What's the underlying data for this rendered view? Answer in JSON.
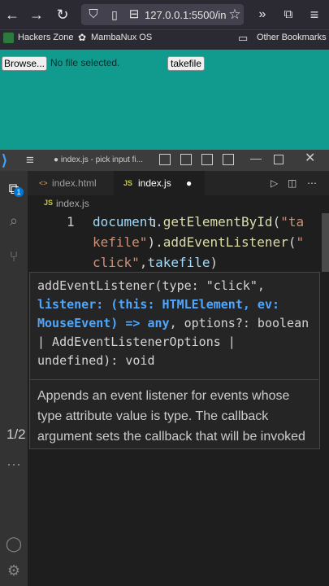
{
  "browser": {
    "url": "127.0.0.1:5500/in",
    "bookmarks": [
      "Hackers Zone",
      "MambaNux OS",
      "Other Bookmarks"
    ]
  },
  "page": {
    "browse_label": "Browse...",
    "no_file": "No file selected.",
    "takefile_label": "takefile"
  },
  "vscode": {
    "window_title": "● index.js - pick input fi...",
    "tabs": [
      "index.html",
      "index.js"
    ],
    "breadcrumb": "index.js",
    "line_number": "1",
    "code_line1_parts": [
      "docume",
      "nt.",
      "getElementById",
      "(",
      "\"ta"
    ],
    "code_line2_parts": [
      "kefile\"",
      ").",
      "addEventListener",
      "(",
      "\""
    ],
    "code_line3_parts": [
      "click\"",
      ",",
      "takefile",
      ")"
    ],
    "hover": {
      "sig_1": "addEventListener(type: \"click\",",
      "sig_2": "listener: (this: HTMLElement, ev: MouseEvent) => any",
      "sig_3": ", options?: boolean | AddEventListenerOptions | undefined): void",
      "doc": "Appends an event listener for events whose type attribute value is type. The callback argument sets the callback that will be invoked when the event is dispatched.",
      "overload": "1/2"
    }
  },
  "colors": {
    "page_bg": "#119a8e",
    "accent": "#4ea7ff"
  }
}
